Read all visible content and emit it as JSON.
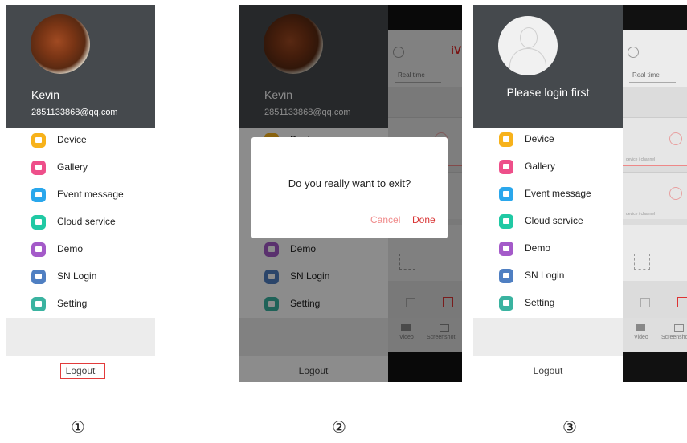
{
  "background": {
    "realtime_label": "Real time",
    "brand_text": "iV",
    "device_label": "device / channel",
    "video_label": "Video",
    "screenshot_label": "Screenshot"
  },
  "user": {
    "name": "Kevin",
    "email": "2851133868@qq.com"
  },
  "login_prompt": "Please login first",
  "menu": [
    {
      "label": "Device",
      "icon": "camera-icon",
      "color": "#f7b21b"
    },
    {
      "label": "Gallery",
      "icon": "image-icon",
      "color": "#ee4f8a"
    },
    {
      "label": "Event message",
      "icon": "mail-icon",
      "color": "#2aa7ec"
    },
    {
      "label": "Cloud service",
      "icon": "cloud-icon",
      "color": "#20c9a4"
    },
    {
      "label": "Demo",
      "icon": "demo-icon",
      "color": "#a45ac9"
    },
    {
      "label": "SN Login",
      "icon": "scan-icon",
      "color": "#4f7fc2"
    },
    {
      "label": "Setting",
      "icon": "gear-icon",
      "color": "#3ab3a0"
    }
  ],
  "logout_label": "Logout",
  "dialog": {
    "question": "Do you really want to exit?",
    "cancel": "Cancel",
    "done": "Done"
  },
  "steps": [
    "①",
    "②",
    "③"
  ]
}
